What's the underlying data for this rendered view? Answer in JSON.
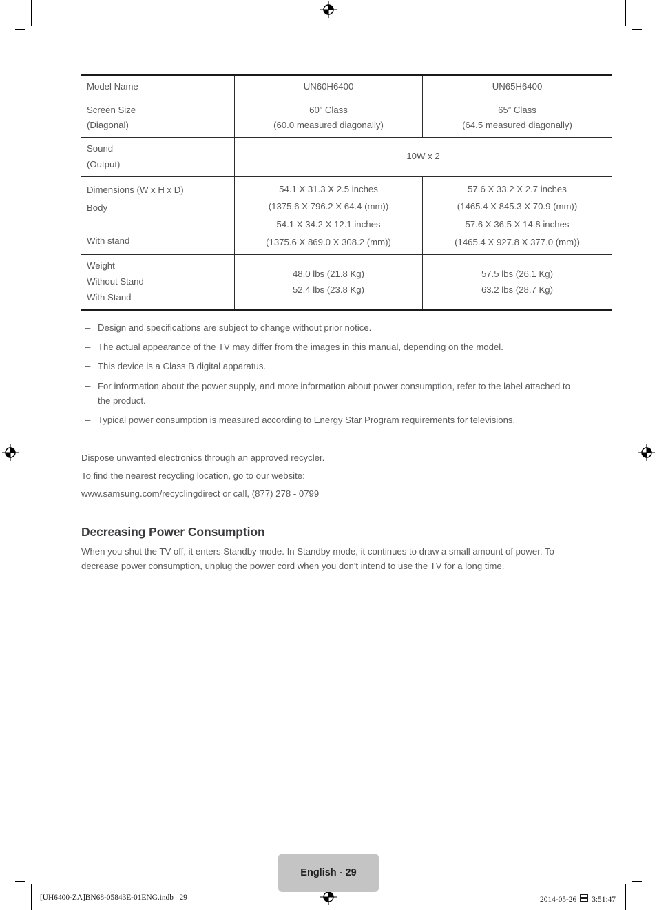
{
  "document": {
    "page_badge": "English - 29",
    "footer_left": "[UH6400-ZA]BN68-05843E-01ENG.indb   29",
    "footer_date": "2014-05-26",
    "footer_time": "3:51:47",
    "footer_glyph": "missing-glyph-box"
  },
  "spec_table": {
    "rows": [
      {
        "label": [
          "Model Name"
        ],
        "col2": [
          "UN60H6400"
        ],
        "col3": [
          "UN65H6400"
        ],
        "span": false
      },
      {
        "label": [
          "Screen Size",
          "(Diagonal)"
        ],
        "col2": [
          "60” Class",
          "(60.0 measured diagonally)"
        ],
        "col3": [
          "65” Class",
          "(64.5 measured diagonally)"
        ],
        "span": false
      },
      {
        "label": [
          "Sound",
          "(Output)"
        ],
        "merged": [
          "10W x 2"
        ],
        "span": true
      },
      {
        "label": [
          "Dimensions (W x H x D)",
          "Body",
          "",
          "With stand"
        ],
        "col2": [
          "54.1 X 31.3 X 2.5 inches",
          "(1375.6 X 796.2 X 64.4 (mm))",
          "54.1 X 34.2 X 12.1 inches",
          "(1375.6 X 869.0 X 308.2 (mm))"
        ],
        "col3": [
          "57.6 X 33.2 X 2.7 inches",
          "(1465.4 X 845.3 X 70.9 (mm))",
          "57.6 X 36.5 X 14.8 inches",
          "(1465.4 X 927.8 X 377.0 (mm))"
        ],
        "span": false
      },
      {
        "label": [
          "Weight",
          "Without Stand",
          "With Stand"
        ],
        "col2": [
          "48.0 lbs (21.8 Kg)",
          "52.4 lbs (23.8 Kg)"
        ],
        "col3": [
          "57.5 lbs (26.1 Kg)",
          "63.2 lbs (28.7 Kg)"
        ],
        "span": false
      }
    ]
  },
  "notes": {
    "dash": "–",
    "items": [
      "Design and specifications are subject to change without prior notice.",
      "The actual appearance of the TV may differ from the images in this manual, depending on the model.",
      "This device is a Class B digital apparatus.",
      "For information about the power supply, and more information about power consumption, refer to the label attached to the product.",
      "Typical power consumption is measured according to Energy Star Program requirements for televisions."
    ]
  },
  "recycling": {
    "line1": "Dispose unwanted electronics through an approved recycler.",
    "line2": "To find the nearest recycling location, go to our website:",
    "line3": "www.samsung.com/recyclingdirect or call, (877) 278 - 0799"
  },
  "section": {
    "title": "Decreasing Power Consumption",
    "body": "When you shut the TV off, it enters Standby mode. In Standby mode, it continues to draw a small amount of power. To decrease power consumption, unplug the power cord when you don't intend to use the TV for a long time."
  }
}
